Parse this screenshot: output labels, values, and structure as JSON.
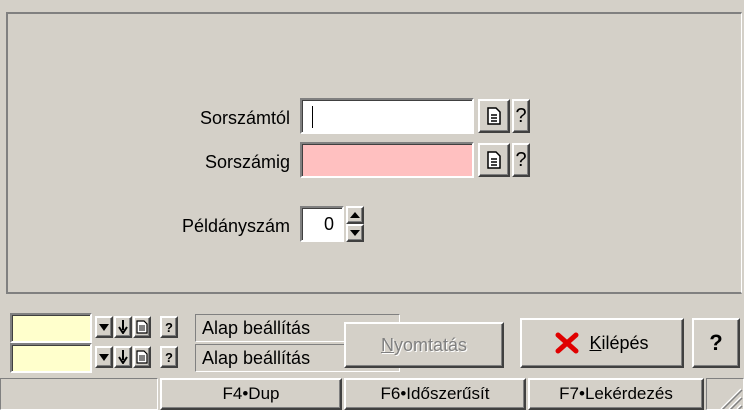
{
  "form": {
    "sorszamtol_label": "Sorszámtól",
    "sorszamig_label": "Sorszámig",
    "peldanyszam_label": "Példányszám",
    "sorszamtol_value": "",
    "sorszamig_value": "",
    "peldanyszam_value": "0",
    "help_glyph": "?",
    "sorszamig_color": "#ffc0c0"
  },
  "bottom": {
    "settings": [
      {
        "label": "Alap beállítás"
      },
      {
        "label": "Alap beállítás"
      }
    ],
    "field_color": "#ffffcc",
    "help_glyph": "?",
    "print_accel": "N",
    "print_rest": "yomtatás",
    "exit_accel": "K",
    "exit_rest": "ilépés",
    "help_button": "?"
  },
  "statusbar": {
    "f4": "F4•Dup",
    "f6": "F6•Időszerűsít",
    "f7": "F7•Lekérdezés"
  },
  "icons": [
    "document-icon",
    "help-icon",
    "spin-up-icon",
    "spin-down-icon",
    "arrow-down-icon",
    "close-x-icon",
    "resize-grip-icon"
  ]
}
